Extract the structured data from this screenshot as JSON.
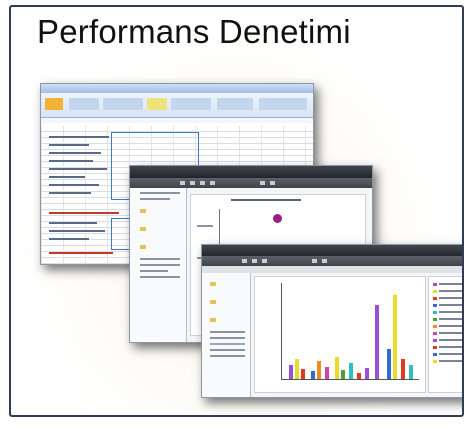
{
  "slide": {
    "title": "Performans Denetimi"
  },
  "screenshots": [
    {
      "name": "spreadsheet-window",
      "icon": "excel-spreadsheet-icon"
    },
    {
      "name": "report-scatter-window",
      "icon": "scatter-chart-icon"
    },
    {
      "name": "report-bar-chart-window",
      "icon": "bar-chart-icon"
    }
  ],
  "colors": {
    "border": "#2f3d57",
    "excel_ribbon": "#d5e3f5",
    "app_title_bar": "#22252b",
    "scatter_point": "#9a1c86",
    "bar_series": [
      "#9b4fd6",
      "#e6dc2a",
      "#e23a1d",
      "#2f6ed0",
      "#2cc0c6",
      "#4d9c35",
      "#f08b1e",
      "#cc44aa"
    ]
  }
}
